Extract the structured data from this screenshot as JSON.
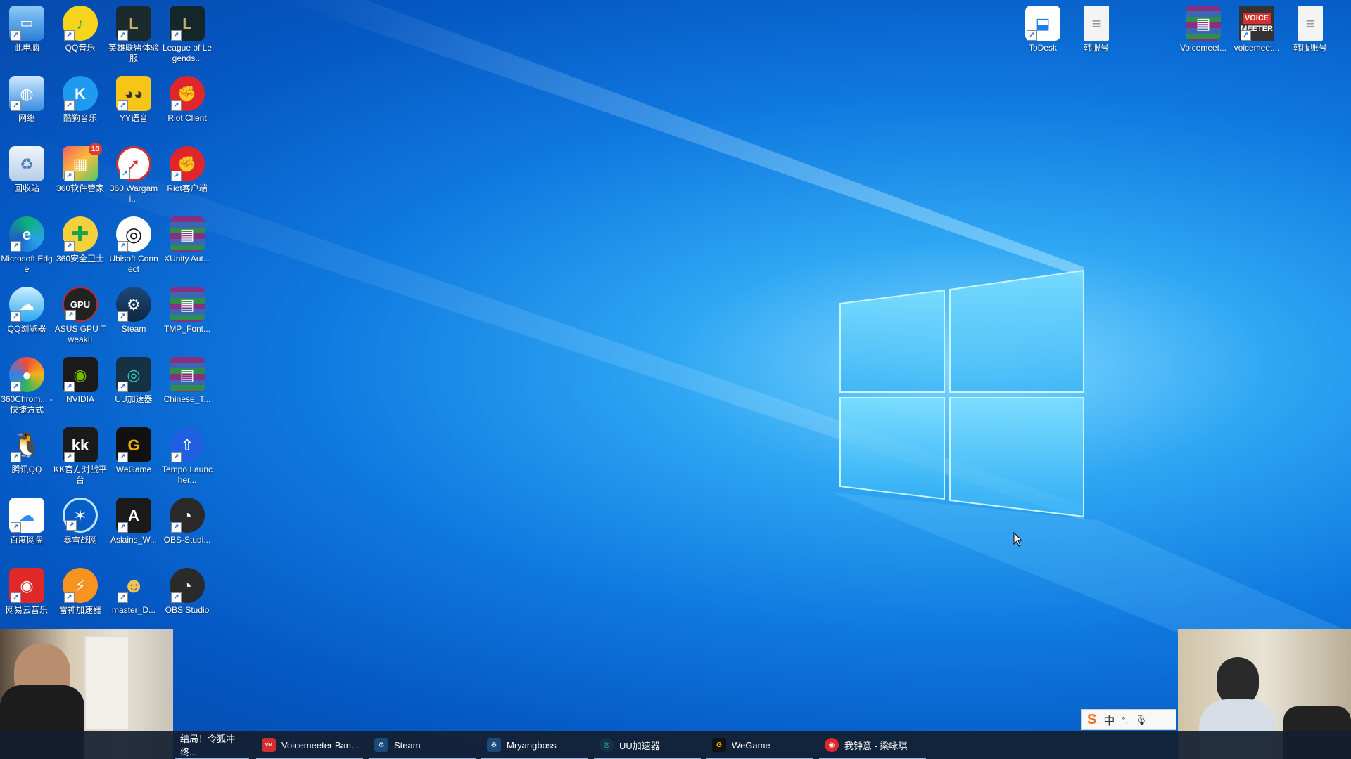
{
  "desktop": {
    "icons": [
      {
        "label": "此电脑",
        "icon": "computer-icon"
      },
      {
        "label": "QQ音乐",
        "icon": "qq-music-icon"
      },
      {
        "label": "英雄联盟体验服",
        "icon": "league-pbe-icon"
      },
      {
        "label": "League of Legends...",
        "icon": "league-icon"
      },
      {
        "label": "网络",
        "icon": "network-icon"
      },
      {
        "label": "酷狗音乐",
        "icon": "kugou-icon"
      },
      {
        "label": "YY语音",
        "icon": "yy-icon"
      },
      {
        "label": "Riot Client",
        "icon": "riot-icon"
      },
      {
        "label": "回收站",
        "icon": "recycle-bin-icon"
      },
      {
        "label": "360软件管家",
        "icon": "360-manager-icon",
        "badge": "10"
      },
      {
        "label": "360 Wargami...",
        "icon": "360-wargaming-icon"
      },
      {
        "label": "Riot客户端",
        "icon": "riot-client-cn-icon"
      },
      {
        "label": "Microsoft Edge",
        "icon": "edge-icon"
      },
      {
        "label": "360安全卫士",
        "icon": "360-safe-icon"
      },
      {
        "label": "Ubisoft Connect",
        "icon": "ubisoft-icon"
      },
      {
        "label": "XUnity.Aut...",
        "icon": "winrar-icon"
      },
      {
        "label": "QQ浏览器",
        "icon": "qq-browser-icon"
      },
      {
        "label": "ASUS GPU TweakII",
        "icon": "asus-gpu-icon"
      },
      {
        "label": "Steam",
        "icon": "steam-icon"
      },
      {
        "label": "TMP_Font...",
        "icon": "winrar-icon"
      },
      {
        "label": "360Chrom... - 快捷方式",
        "icon": "360-chrome-icon"
      },
      {
        "label": "NVIDIA",
        "icon": "nvidia-icon"
      },
      {
        "label": "UU加速器",
        "icon": "uu-icon"
      },
      {
        "label": "Chinese_T...",
        "icon": "winrar-icon"
      },
      {
        "label": "腾讯QQ",
        "icon": "qq-penguin-icon"
      },
      {
        "label": "KK官方对战平台",
        "icon": "kk-icon"
      },
      {
        "label": "WeGame",
        "icon": "wegame-icon"
      },
      {
        "label": "Tempo Launcher...",
        "icon": "tempo-icon"
      },
      {
        "label": "百度网盘",
        "icon": "baidu-pan-icon"
      },
      {
        "label": "暴雪战网",
        "icon": "battlenet-icon"
      },
      {
        "label": "Aslains_W...",
        "icon": "aslain-icon"
      },
      {
        "label": "OBS-Studi...",
        "icon": "obs-icon"
      },
      {
        "label": "网易云音乐",
        "icon": "netease-music-icon"
      },
      {
        "label": "雷神加速器",
        "icon": "leishen-icon"
      },
      {
        "label": "master_D...",
        "icon": "master-duel-icon"
      },
      {
        "label": "OBS Studio",
        "icon": "obs-icon"
      }
    ],
    "right_icons": [
      {
        "label": "ToDesk",
        "icon": "todesk-icon"
      },
      {
        "label": "韩服号",
        "icon": "text-file-icon"
      },
      {
        "label": "Voicemeet...",
        "icon": "winrar-icon"
      },
      {
        "label": "voicemeet...",
        "icon": "voicemeeter-icon"
      },
      {
        "label": "韩服账号",
        "icon": "text-file-icon"
      }
    ],
    "voicemeeter_logo": {
      "line1": "VOICE",
      "line2": "MEETER"
    }
  },
  "taskbar": {
    "items": [
      {
        "label": "结局！令狐冲终...",
        "icon": ""
      },
      {
        "label": "Voicemeeter Ban...",
        "icon": "voicemeeter-icon"
      },
      {
        "label": "Steam",
        "icon": "steam-icon"
      },
      {
        "label": "Mryangboss",
        "icon": "steam-icon"
      },
      {
        "label": "UU加速器",
        "icon": "uu-icon"
      },
      {
        "label": "WeGame",
        "icon": "wegame-icon"
      },
      {
        "label": "我钟意 - 梁咏琪",
        "icon": "netease-music-icon"
      }
    ]
  },
  "ime": {
    "logo": "S",
    "mode": "中",
    "punct": "°,",
    "mic": "🎙"
  },
  "colors": {
    "wallpaper": "#0f79e0",
    "taskbar": "#141e30",
    "accent": "#9bb6d9"
  }
}
